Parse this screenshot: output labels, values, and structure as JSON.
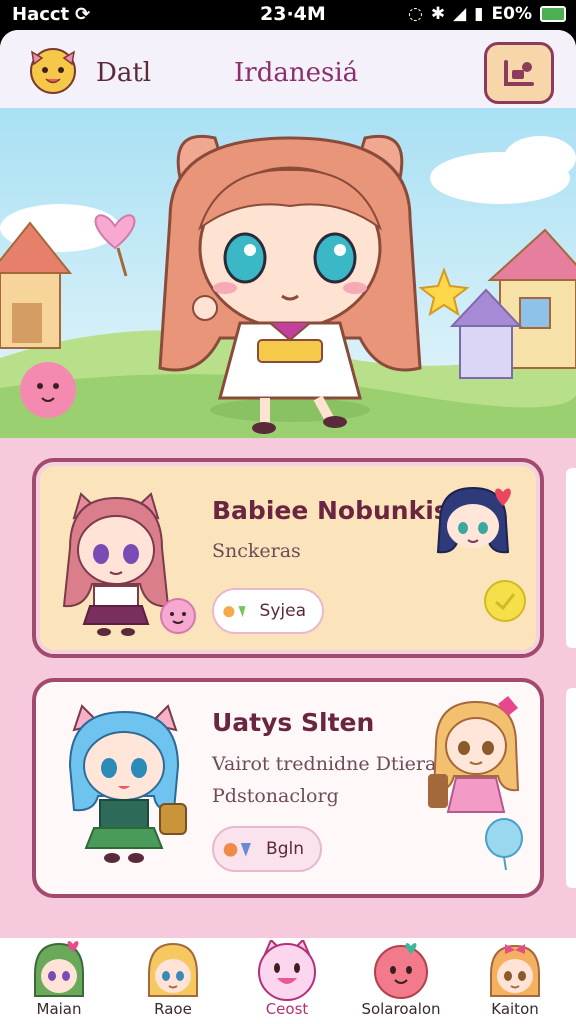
{
  "status": {
    "left": "Hacct",
    "time": "23·4M",
    "battery": "E0%"
  },
  "header": {
    "left_text": "Datl",
    "title": "Irdanesiá"
  },
  "cards": [
    {
      "title": "Babiee Nobunkis",
      "subtitle": "Snckeras",
      "pill_label": "Syjea"
    },
    {
      "title": "Uatys Slten",
      "subtitle": "Vairot trednidne Dtiera Pdstonaclorg",
      "pill_label": "Bgln"
    }
  ],
  "nav": {
    "items": [
      {
        "label": "Maian",
        "icon": "green-hair-avatar-icon"
      },
      {
        "label": "Raoe",
        "icon": "blonde-avatar-icon"
      },
      {
        "label": "Ceost",
        "icon": "pink-cat-icon",
        "active": true
      },
      {
        "label": "Solaroalon",
        "icon": "pink-blob-icon"
      },
      {
        "label": "Kaiton",
        "icon": "bow-girl-avatar-icon"
      }
    ]
  },
  "colors": {
    "accent": "#8b2f6f",
    "card_border": "#a14a6e",
    "background": "#fbe3ee"
  }
}
